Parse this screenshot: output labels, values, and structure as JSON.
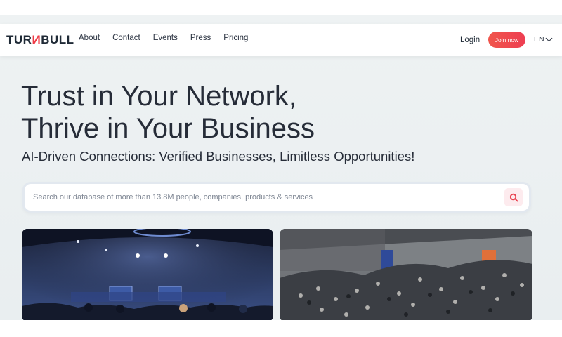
{
  "brand": {
    "logo_prefix": "TUR",
    "logo_n": "N",
    "logo_suffix": "BULL"
  },
  "nav": {
    "links": [
      "About",
      "Contact",
      "Events",
      "Press",
      "Pricing"
    ],
    "login_label": "Login",
    "join_label": "Join now",
    "language": "EN"
  },
  "hero": {
    "title_line1": "Trust in Your Network,",
    "title_line2": "Thrive in Your Business",
    "subtitle": "AI-Driven Connections: Verified Businesses, Limitless Opportunities!"
  },
  "search": {
    "placeholder": "Search our database of more than 13.8M people, companies, products & services",
    "icon": "search-icon"
  },
  "colors": {
    "accent": "#ef3a45",
    "text_dark": "#262c38",
    "page_bg": "#eef2f3"
  },
  "images": [
    {
      "name": "conference-stage-photo",
      "icon": "image"
    },
    {
      "name": "crowd-hall-photo",
      "icon": "image"
    }
  ]
}
